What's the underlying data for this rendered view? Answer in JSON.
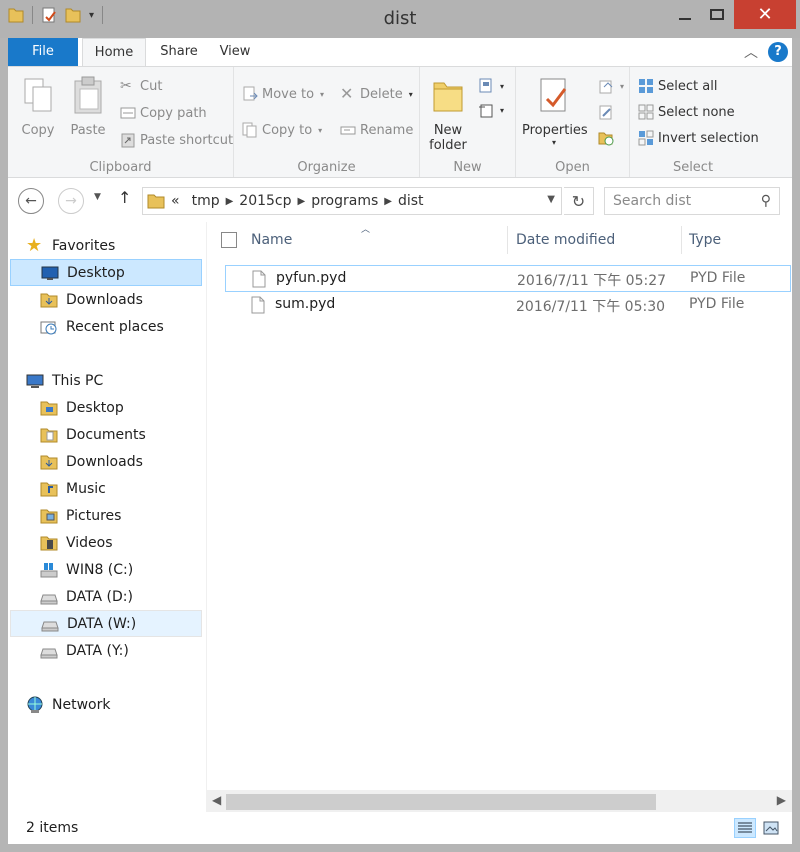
{
  "window": {
    "title": "dist"
  },
  "ribbon": {
    "tabs": {
      "file": "File",
      "home": "Home",
      "share": "Share",
      "view": "View"
    },
    "clipboard": {
      "label": "Clipboard",
      "copy": "Copy",
      "paste": "Paste",
      "cut": "Cut",
      "copy_path": "Copy path",
      "paste_shortcut": "Paste shortcut"
    },
    "organize": {
      "label": "Organize",
      "move_to": "Move to",
      "copy_to": "Copy to",
      "delete": "Delete",
      "rename": "Rename"
    },
    "new": {
      "label": "New",
      "new_folder_line1": "New",
      "new_folder_line2": "folder"
    },
    "open": {
      "label": "Open",
      "properties": "Properties"
    },
    "select": {
      "label": "Select",
      "select_all": "Select all",
      "select_none": "Select none",
      "invert_selection": "Invert selection"
    }
  },
  "address": {
    "prefix": "«",
    "crumbs": [
      "tmp",
      "2015cp",
      "programs",
      "dist"
    ],
    "search_placeholder": "Search dist"
  },
  "navpane": {
    "favorites": "Favorites",
    "fav_items": [
      "Desktop",
      "Downloads",
      "Recent places"
    ],
    "this_pc": "This PC",
    "pc_items": [
      "Desktop",
      "Documents",
      "Downloads",
      "Music",
      "Pictures",
      "Videos",
      "WIN8 (C:)",
      "DATA (D:)",
      "DATA (W:)",
      "DATA (Y:)"
    ],
    "network": "Network"
  },
  "content": {
    "columns": {
      "name": "Name",
      "date": "Date modified",
      "type": "Type"
    },
    "files": [
      {
        "name": "pyfun.pyd",
        "date": "2016/7/11 下午 05:27",
        "type": "PYD File"
      },
      {
        "name": "sum.pyd",
        "date": "2016/7/11 下午 05:30",
        "type": "PYD File"
      }
    ]
  },
  "status": {
    "items": "2 items"
  },
  "colors": {
    "accent": "#1979ca",
    "selected": "#cce8ff",
    "close": "#c84031"
  }
}
